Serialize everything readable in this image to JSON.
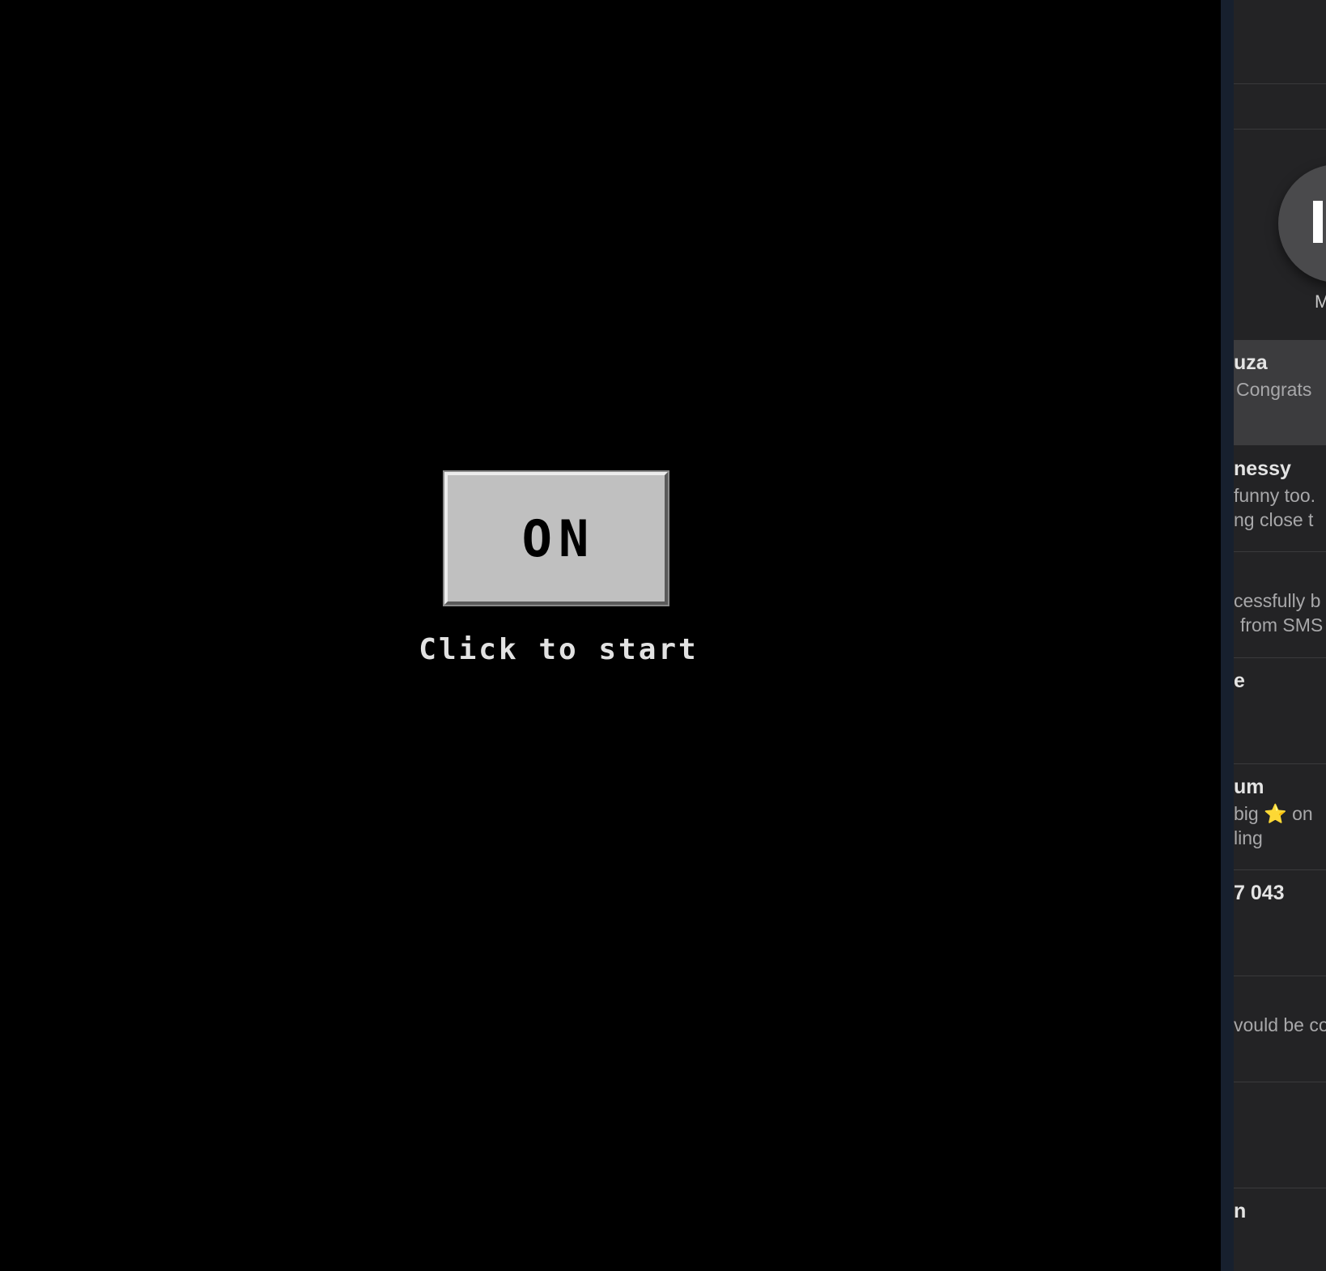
{
  "game": {
    "power_button_label": "ON",
    "start_hint": "Click to start"
  },
  "sidebar": {
    "pinned_name": "M",
    "conversations": [
      {
        "title": "uza",
        "line1": "Congrats",
        "line2": ""
      },
      {
        "title": "nessy",
        "line1": "funny too.",
        "line2": "ng close t"
      },
      {
        "title": "",
        "line1": "cessfully b",
        "line2": "from SMS"
      },
      {
        "title": "e",
        "line1": "",
        "line2": ""
      },
      {
        "title": "um",
        "line1": "big ⭐ on",
        "line2": "ling"
      },
      {
        "title": "7 043",
        "line1": "",
        "line2": ""
      },
      {
        "title": "",
        "line1": "vould be co",
        "line2": ""
      },
      {
        "title": "",
        "line1": "",
        "line2": ""
      },
      {
        "title": "n",
        "line1": "",
        "line2": ""
      }
    ]
  }
}
